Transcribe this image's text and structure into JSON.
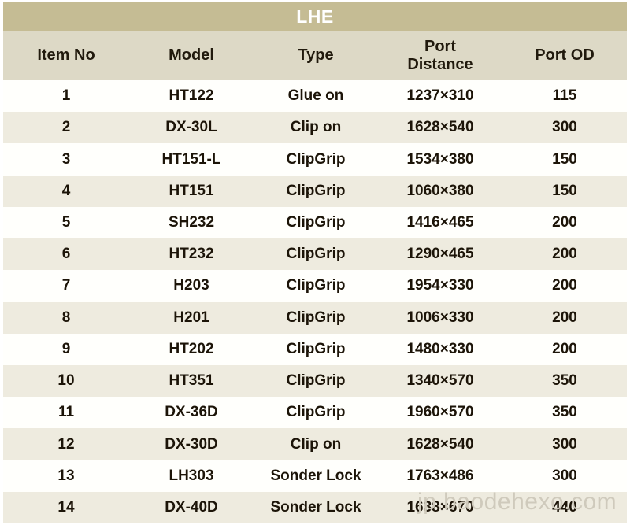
{
  "table": {
    "title": "LHE",
    "columns": [
      {
        "label": "Item No",
        "lines": [
          "Item No"
        ]
      },
      {
        "label": "Model",
        "lines": [
          "Model"
        ]
      },
      {
        "label": "Type",
        "lines": [
          "Type"
        ]
      },
      {
        "label": "Port Distance",
        "lines": [
          "Port",
          "Distance"
        ]
      },
      {
        "label": "Port OD",
        "lines": [
          "Port OD"
        ]
      }
    ],
    "rows": [
      {
        "item_no": "1",
        "model": "HT122",
        "type": "Glue on",
        "port_distance": "1237×310",
        "port_od": "115"
      },
      {
        "item_no": "2",
        "model": "DX-30L",
        "type": "Clip on",
        "port_distance": "1628×540",
        "port_od": "300"
      },
      {
        "item_no": "3",
        "model": "HT151-L",
        "type": "ClipGrip",
        "port_distance": "1534×380",
        "port_od": "150"
      },
      {
        "item_no": "4",
        "model": "HT151",
        "type": "ClipGrip",
        "port_distance": "1060×380",
        "port_od": "150"
      },
      {
        "item_no": "5",
        "model": "SH232",
        "type": "ClipGrip",
        "port_distance": "1416×465",
        "port_od": "200"
      },
      {
        "item_no": "6",
        "model": "HT232",
        "type": "ClipGrip",
        "port_distance": "1290×465",
        "port_od": "200"
      },
      {
        "item_no": "7",
        "model": "H203",
        "type": "ClipGrip",
        "port_distance": "1954×330",
        "port_od": "200"
      },
      {
        "item_no": "8",
        "model": "H201",
        "type": "ClipGrip",
        "port_distance": "1006×330",
        "port_od": "200"
      },
      {
        "item_no": "9",
        "model": "HT202",
        "type": "ClipGrip",
        "port_distance": "1480×330",
        "port_od": "200"
      },
      {
        "item_no": "10",
        "model": "HT351",
        "type": "ClipGrip",
        "port_distance": "1340×570",
        "port_od": "350"
      },
      {
        "item_no": "11",
        "model": "DX-36D",
        "type": "ClipGrip",
        "port_distance": "1960×570",
        "port_od": "350"
      },
      {
        "item_no": "12",
        "model": "DX-30D",
        "type": "Clip on",
        "port_distance": "1628×540",
        "port_od": "300"
      },
      {
        "item_no": "13",
        "model": "LH303",
        "type": "Sonder Lock",
        "port_distance": "1763×486",
        "port_od": "300"
      },
      {
        "item_no": "14",
        "model": "DX-40D",
        "type": "Sonder Lock",
        "port_distance": "1638×670",
        "port_od": "440"
      }
    ]
  },
  "watermark": {
    "text": "jp.baodehexo.com"
  },
  "colors": {
    "title_bar": "#c5bc94",
    "title_text": "#ffffff",
    "header_row": "#ddd9c6",
    "row_odd": "#fffffc",
    "row_even": "#eeebdf",
    "text": "#1c1408",
    "watermark": "#cfcabc"
  }
}
